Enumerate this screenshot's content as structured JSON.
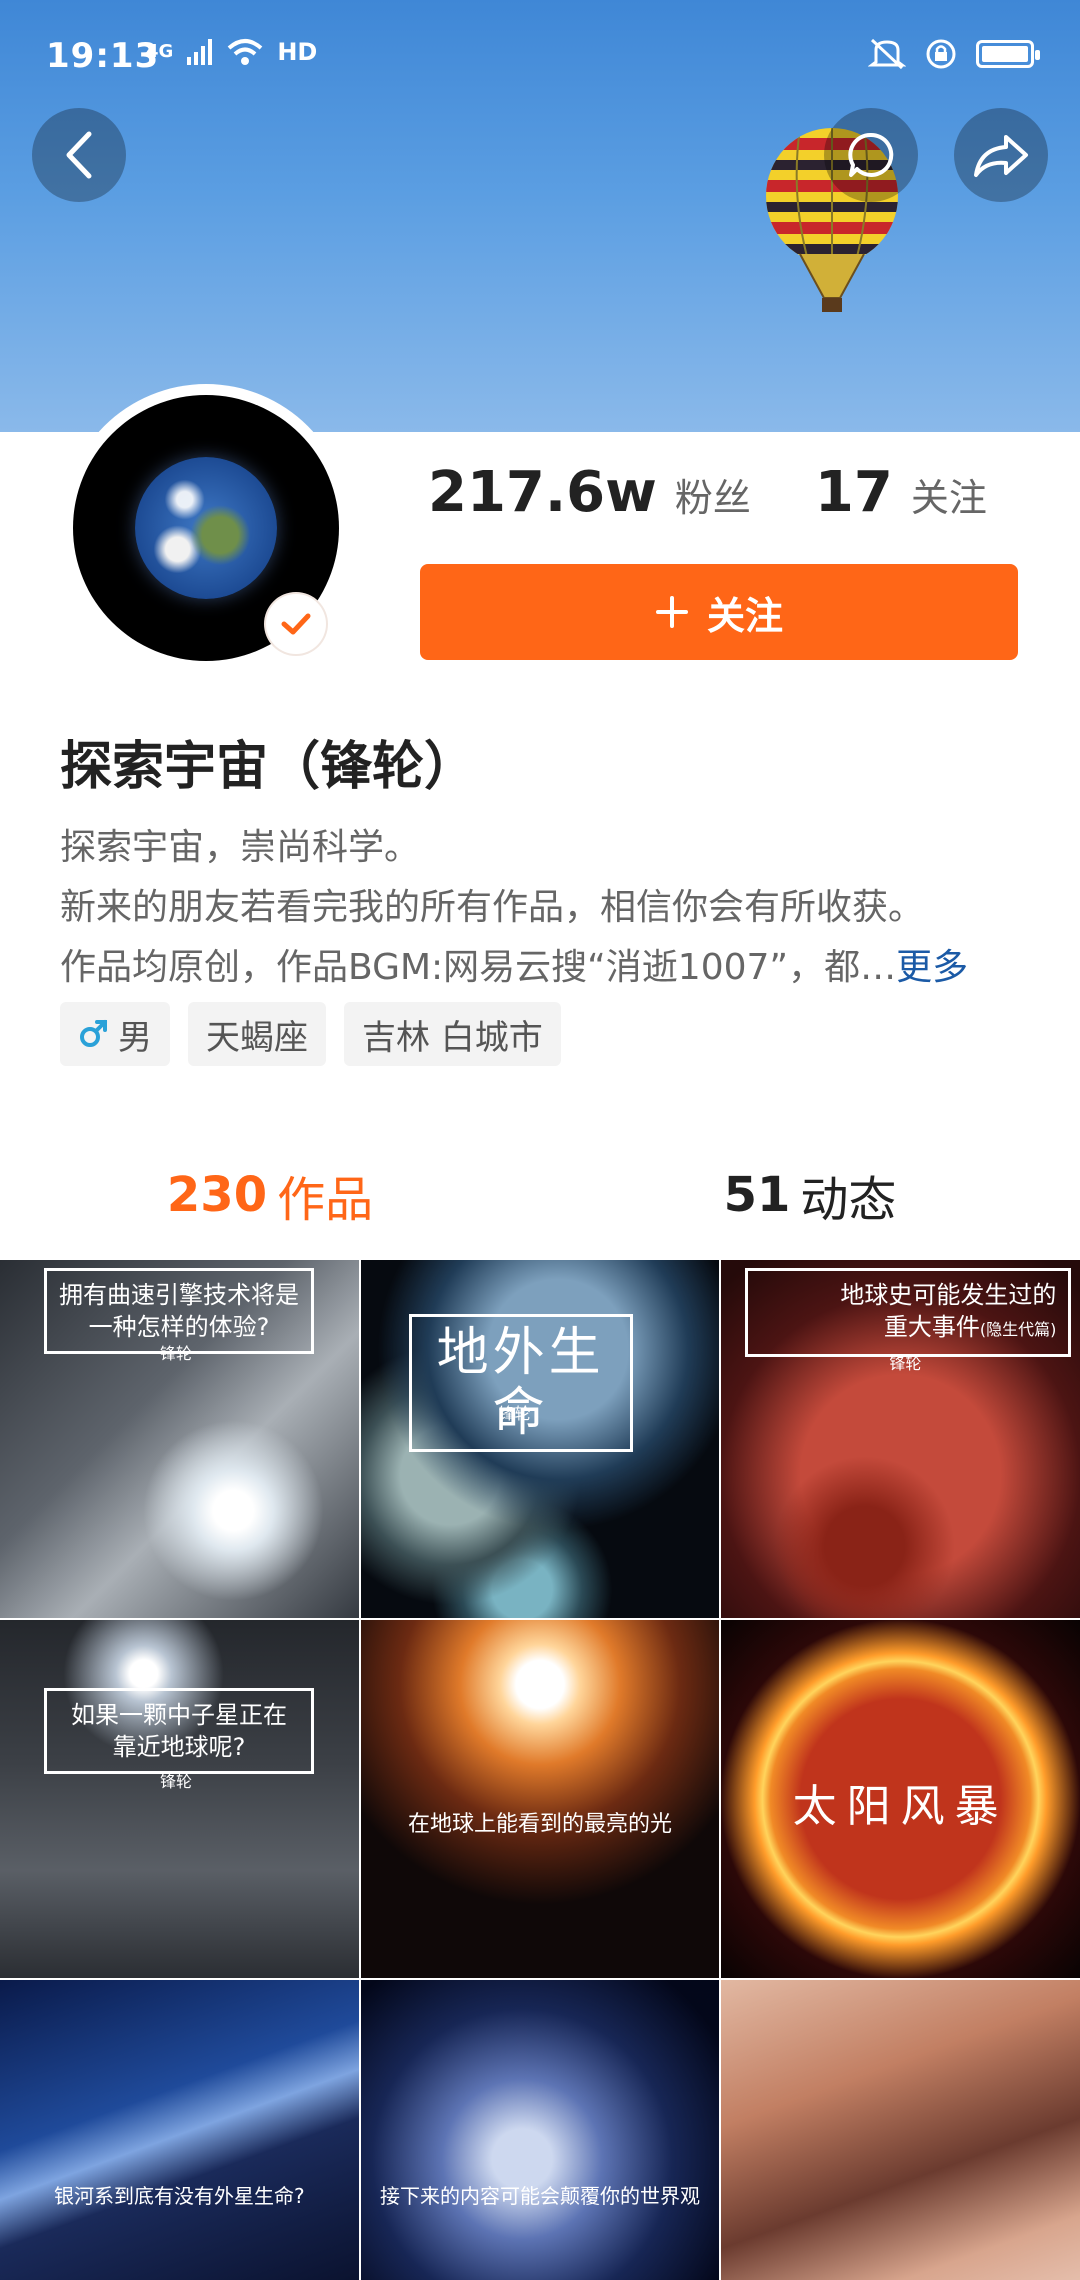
{
  "status_bar": {
    "time": "19:13",
    "network": "4G",
    "hd": "HD"
  },
  "header": {
    "back_icon": "chevron-left-icon",
    "message_icon": "chat-bubble-icon",
    "share_icon": "share-arrow-icon"
  },
  "profile": {
    "fans_count": "217.6w",
    "fans_label": "粉丝",
    "following_count": "17",
    "following_label": "关注",
    "follow_button": "关注",
    "follow_button_icon": "plus-icon",
    "name": "探索宇宙（锋轮）",
    "bio_line1": "探索宇宙，崇尚科学。",
    "bio_line2": "新来的朋友若看完我的所有作品，相信你会有所收获。",
    "bio_line3": "作品均原创，作品BGM:网易云搜“消逝1007”，都…",
    "bio_more": "更多",
    "tags": [
      "男",
      "天蝎座",
      "吉林 白城市"
    ]
  },
  "tabs": [
    {
      "count": "230",
      "label": "作品",
      "active": true
    },
    {
      "count": "51",
      "label": "动态",
      "active": false
    }
  ],
  "videos": [
    {
      "title_line1": "拥有曲速引擎技术将是",
      "title_line2": "一种怎样的体验?",
      "author": "锋轮"
    },
    {
      "title": "地外生命",
      "author": "锋轮"
    },
    {
      "title_line1": "地球史可能发生过的",
      "title_line2": "重大事件",
      "title_sub": "(隐生代篇)",
      "author": "锋轮"
    },
    {
      "title_line1": "如果一颗中子星正在",
      "title_line2": "靠近地球呢?",
      "author": "锋轮"
    },
    {
      "title": "在地球上能看到的最亮的光"
    },
    {
      "title": "太阳风暴"
    },
    {
      "title": "银河系到底有没有外星生命?"
    },
    {
      "title": "接下来的内容可能会颠覆你的世界观"
    },
    {
      "title": ""
    }
  ],
  "colors": {
    "accent": "#ff6617",
    "link": "#1b5aa6"
  }
}
